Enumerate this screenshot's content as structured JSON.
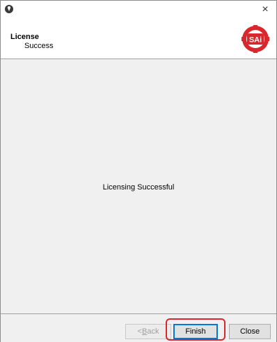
{
  "window": {
    "close_glyph": "×"
  },
  "header": {
    "title": "License",
    "subtitle": "Success",
    "logo_text": "SAi",
    "logo_color": "#d9272e"
  },
  "main": {
    "message": "Licensing Successful"
  },
  "footer": {
    "back_label_prefix": "< ",
    "back_label_mnemonic": "B",
    "back_label_rest": "ack",
    "finish_label": "Finish",
    "close_label": "Close"
  },
  "colors": {
    "highlight": "#d9272e",
    "focus": "#0078d7"
  }
}
